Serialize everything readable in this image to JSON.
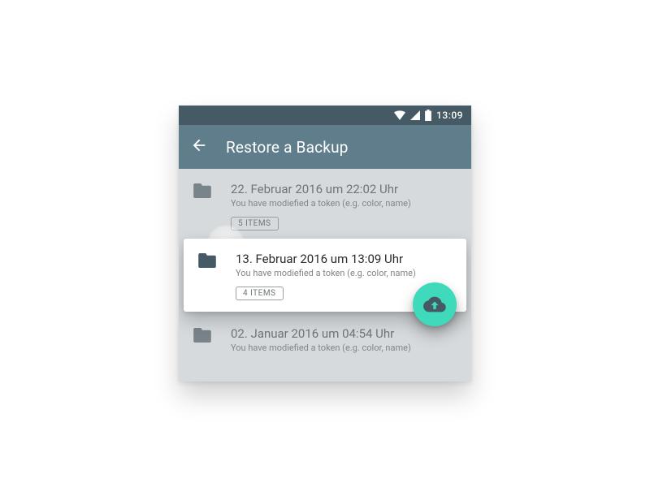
{
  "status_bar": {
    "time": "13:09"
  },
  "app_bar": {
    "title": "Restore a Backup"
  },
  "backups": [
    {
      "title": "22. Februar 2016 um 22:02 Uhr",
      "subtitle": "You have modiefied a token (e.g. color, name)",
      "chip": "5 ITEMS"
    },
    {
      "title": "13. Februar 2016 um 13:09 Uhr",
      "subtitle": "You have modiefied a token (e.g. color, name)",
      "chip": "4 ITEMS"
    },
    {
      "title": "02. Januar 2016 um 04:54 Uhr",
      "subtitle": "You have modiefied a token (e.g. color, name)",
      "chip": ""
    }
  ]
}
